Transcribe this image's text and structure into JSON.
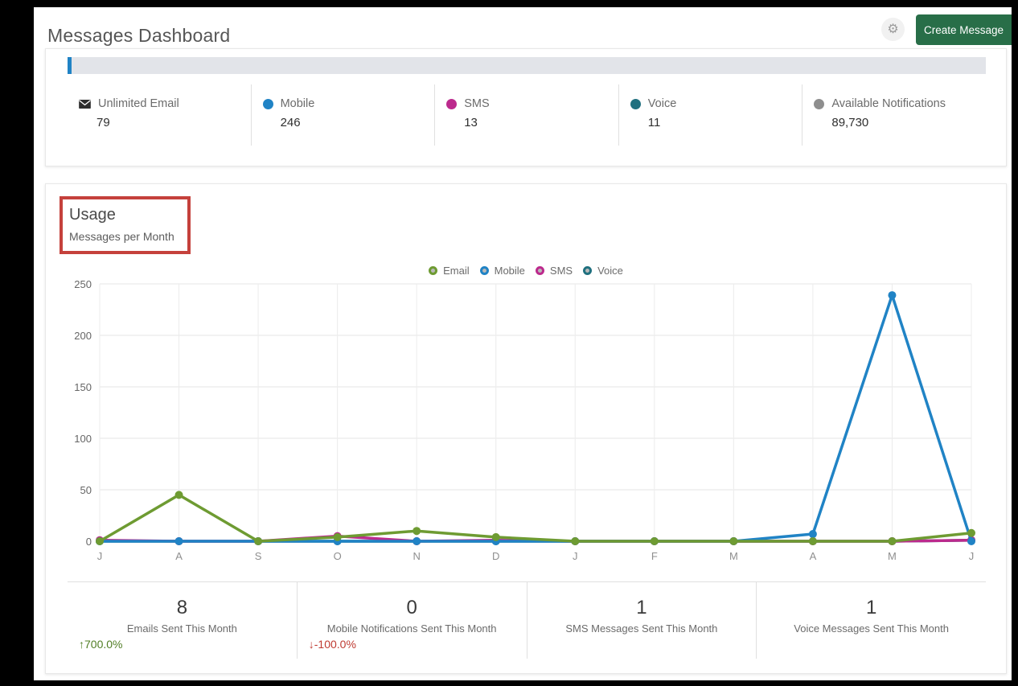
{
  "header": {
    "title": "Messages Dashboard",
    "create_button_label": "Create Message",
    "create_button_color": "#286e48",
    "gear_glyph": "⚙"
  },
  "plan_usage_bar": {
    "track_color": "#e2e4e9",
    "fill_color": "#2083c5"
  },
  "summary_stats": {
    "items": [
      {
        "icon": "envelope-icon",
        "color": "#2d2d2d",
        "label": "Unlimited Email",
        "value": "79"
      },
      {
        "icon": "dot-icon",
        "color": "#2083c5",
        "label": "Mobile",
        "value": "246"
      },
      {
        "icon": "dot-icon",
        "color": "#bc2a8d",
        "label": "SMS",
        "value": "13"
      },
      {
        "icon": "dot-icon",
        "color": "#20707f",
        "label": "Voice",
        "value": "11"
      },
      {
        "icon": "dot-icon",
        "color": "#8e8e8e",
        "label": "Available Notifications",
        "value": "89,730"
      }
    ]
  },
  "usage": {
    "title": "Usage",
    "subtitle": "Messages per Month",
    "annotation_color": "#c5413c"
  },
  "chart_data": {
    "type": "line",
    "title": "Usage — Messages per Month",
    "categories": [
      "J",
      "A",
      "S",
      "O",
      "N",
      "D",
      "J",
      "F",
      "M",
      "A",
      "M",
      "J"
    ],
    "series": [
      {
        "name": "Email",
        "color": "#6e9b32",
        "values": [
          0,
          45,
          0,
          4,
          10,
          4,
          0,
          0,
          0,
          0,
          0,
          8
        ]
      },
      {
        "name": "Mobile",
        "color": "#2083c5",
        "values": [
          0,
          0,
          0,
          0,
          0,
          0,
          0,
          0,
          0,
          7,
          239,
          0
        ]
      },
      {
        "name": "SMS",
        "color": "#bc2a8d",
        "values": [
          1,
          0,
          0,
          5,
          0,
          1,
          0,
          0,
          0,
          0,
          0,
          1
        ]
      },
      {
        "name": "Voice",
        "color": "#20707f",
        "values": [
          0,
          0,
          0,
          0,
          0,
          0,
          0,
          0,
          0,
          0,
          0,
          1
        ]
      }
    ],
    "ylim": [
      0,
      250
    ],
    "yticks": [
      0,
      50,
      100,
      150,
      200,
      250
    ],
    "legend_position": "top",
    "grid": true
  },
  "monthly_stats": {
    "items": [
      {
        "value": "8",
        "label": "Emails Sent This Month",
        "delta": "↑700.0%",
        "delta_color": "#507d24"
      },
      {
        "value": "0",
        "label": "Mobile Notifications Sent This Month",
        "delta": "↓-100.0%",
        "delta_color": "#bf3a31"
      },
      {
        "value": "1",
        "label": "SMS Messages Sent This Month",
        "delta": "",
        "delta_color": ""
      },
      {
        "value": "1",
        "label": "Voice Messages Sent This Month",
        "delta": "",
        "delta_color": ""
      }
    ]
  }
}
